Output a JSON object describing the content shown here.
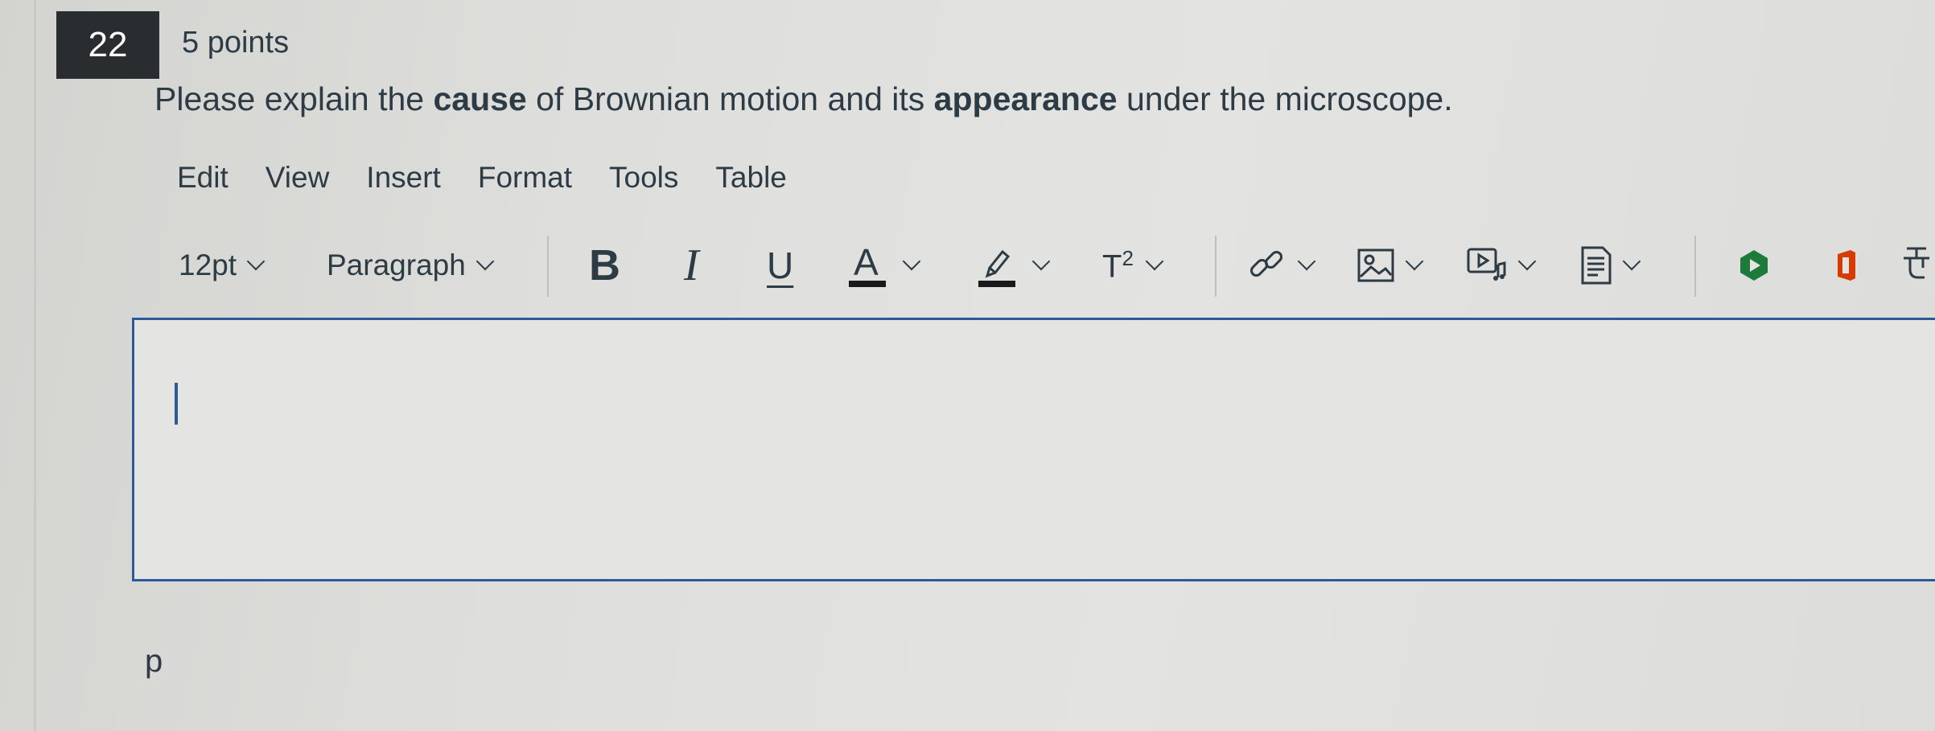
{
  "question": {
    "number": "22",
    "points": "5 points",
    "text_part1": "Please explain the ",
    "text_bold1": "cause",
    "text_part2": " of Brownian motion and its ",
    "text_bold2": "appearance",
    "text_part3": " under the microscope."
  },
  "menubar": {
    "items": [
      "Edit",
      "View",
      "Insert",
      "Format",
      "Tools",
      "Table"
    ]
  },
  "toolbar": {
    "font_size": "12pt",
    "block_format": "Paragraph",
    "bold": "B",
    "italic": "I",
    "underline": "U",
    "text_color": "A",
    "superscript": "T",
    "superscript_exp": "2",
    "icons": [
      "chevron-down-icon",
      "bold-icon",
      "italic-icon",
      "underline-icon",
      "text-color-icon",
      "highlight-icon",
      "superscript-icon",
      "link-icon",
      "image-icon",
      "media-icon",
      "document-icon",
      "apps-icon",
      "office-icon",
      "more-icon"
    ]
  },
  "editor": {
    "content": ""
  },
  "status_path": "p",
  "colors": {
    "accent": "#2b5a9b",
    "text": "#2d3b45",
    "badge_bg": "#2a2d2f",
    "apps_green": "#1e7a3a",
    "office_red": "#d83b01"
  }
}
